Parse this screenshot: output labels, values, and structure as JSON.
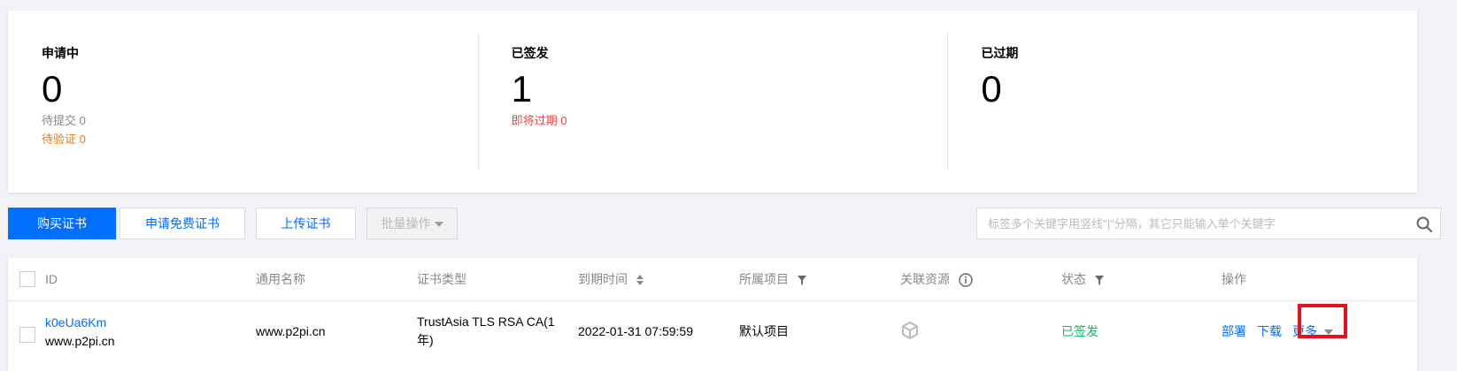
{
  "summary": {
    "applying": {
      "title": "申请中",
      "count": "0",
      "pending_submit": "待提交 0",
      "pending_verify": "待验证 0"
    },
    "issued": {
      "title": "已签发",
      "count": "1",
      "expiring_soon": "即将过期 0"
    },
    "expired": {
      "title": "已过期",
      "count": "0"
    }
  },
  "toolbar": {
    "buy_label": "购买证书",
    "apply_free_label": "申请免费证书",
    "upload_label": "上传证书",
    "batch_label": "批量操作",
    "search_placeholder": "标签多个关键字用竖线\"|\"分隔，其它只能输入单个关键字"
  },
  "table": {
    "columns": [
      "ID",
      "通用名称",
      "证书类型",
      "到期时间",
      "所属项目",
      "关联资源",
      "状态",
      "操作"
    ],
    "rows": [
      {
        "id": "k0eUa6Km",
        "domain": "www.p2pi.cn",
        "common_name": "www.p2pi.cn",
        "cert_type": "TrustAsia TLS RSA CA(1年)",
        "expires": "2022-01-31 07:59:59",
        "project": "默认项目",
        "status": "已签发",
        "actions": {
          "deploy": "部署",
          "download": "下载",
          "more": "更多"
        }
      }
    ]
  },
  "colors": {
    "primary": "#006eff",
    "orange": "#ff7200",
    "red": "#e54545",
    "green": "#0abf5b",
    "highlight": "#e8101d"
  }
}
